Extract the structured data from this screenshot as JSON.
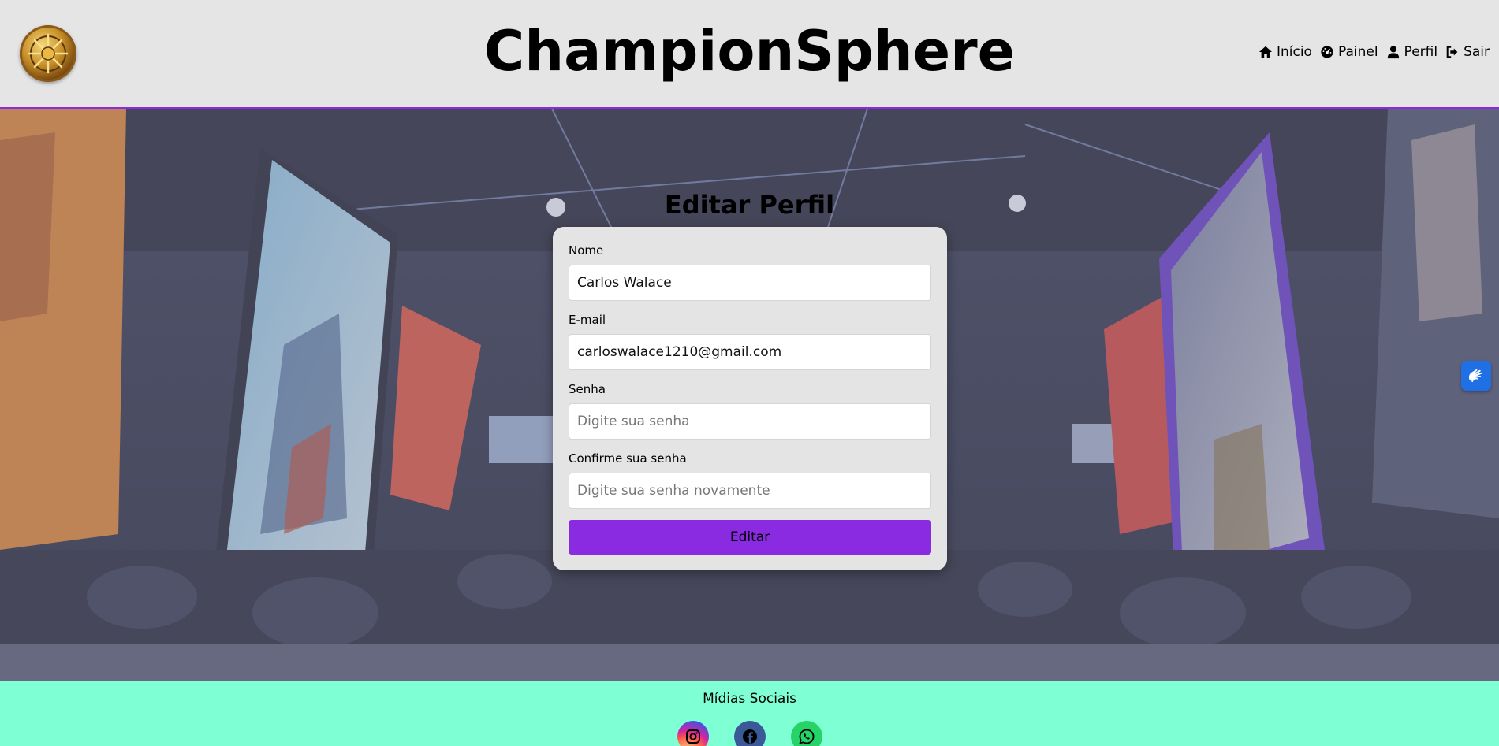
{
  "header": {
    "title": "ChampionSphere",
    "nav": [
      {
        "label": "Início",
        "icon": "home-icon"
      },
      {
        "label": "Painel",
        "icon": "dashboard-icon"
      },
      {
        "label": "Perfil",
        "icon": "user-icon"
      },
      {
        "label": "Sair",
        "icon": "sign-out-icon"
      }
    ]
  },
  "form": {
    "title": "Editar Perfil",
    "name_label": "Nome",
    "name_value": "Carlos Walace",
    "email_label": "E-mail",
    "email_value": "carloswalace1210@gmail.com",
    "password_label": "Senha",
    "password_placeholder": "Digite sua senha",
    "confirm_label": "Confirme sua senha",
    "confirm_placeholder": "Digite sua senha novamente",
    "submit_label": "Editar"
  },
  "footer": {
    "title": "Mídias Sociais",
    "socials": [
      "instagram-icon",
      "facebook-icon",
      "whatsapp-icon"
    ]
  },
  "colors": {
    "accent": "#8a2be2",
    "footer_bg": "#7fffd4",
    "header_bg": "#e5e5e5"
  }
}
